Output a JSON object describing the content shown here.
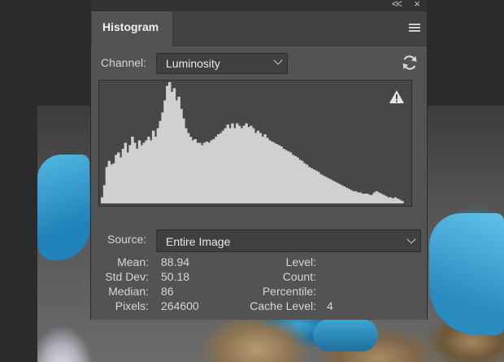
{
  "panel": {
    "tab_title": "Histogram",
    "collapse_glyph": "<<",
    "close_glyph": "×",
    "menu_icon": "hamburger-menu-icon"
  },
  "channel": {
    "label": "Channel:",
    "value": "Luminosity"
  },
  "source": {
    "label": "Source:",
    "value": "Entire Image"
  },
  "histogram": {
    "warning_icon": "warning-triangle-icon",
    "fill_color": "#d0d0d0",
    "profile": [
      0.05,
      0.15,
      0.3,
      0.35,
      0.32,
      0.33,
      0.4,
      0.42,
      0.38,
      0.45,
      0.5,
      0.42,
      0.48,
      0.55,
      0.5,
      0.45,
      0.52,
      0.48,
      0.5,
      0.52,
      0.55,
      0.52,
      0.6,
      0.55,
      0.62,
      0.68,
      0.75,
      0.85,
      0.97,
      1.0,
      0.92,
      0.95,
      0.85,
      0.88,
      0.78,
      0.7,
      0.62,
      0.58,
      0.55,
      0.52,
      0.53,
      0.5,
      0.5,
      0.48,
      0.5,
      0.51,
      0.5,
      0.52,
      0.53,
      0.55,
      0.57,
      0.58,
      0.6,
      0.62,
      0.65,
      0.62,
      0.66,
      0.62,
      0.66,
      0.64,
      0.62,
      0.64,
      0.66,
      0.63,
      0.64,
      0.62,
      0.58,
      0.6,
      0.58,
      0.55,
      0.57,
      0.54,
      0.52,
      0.51,
      0.5,
      0.49,
      0.48,
      0.47,
      0.45,
      0.44,
      0.43,
      0.42,
      0.4,
      0.39,
      0.38,
      0.36,
      0.35,
      0.33,
      0.32,
      0.3,
      0.29,
      0.28,
      0.27,
      0.26,
      0.24,
      0.23,
      0.22,
      0.21,
      0.2,
      0.19,
      0.18,
      0.17,
      0.16,
      0.15,
      0.14,
      0.13,
      0.12,
      0.11,
      0.1,
      0.1,
      0.09,
      0.09,
      0.08,
      0.08,
      0.08,
      0.07,
      0.07,
      0.09,
      0.1,
      0.09,
      0.08,
      0.07,
      0.06,
      0.05,
      0.05,
      0.04,
      0.05,
      0.04,
      0.03,
      0.02
    ]
  },
  "stats": {
    "mean": {
      "label": "Mean:",
      "value": "88.94"
    },
    "std_dev": {
      "label": "Std Dev:",
      "value": "50.18"
    },
    "median": {
      "label": "Median:",
      "value": "86"
    },
    "pixels": {
      "label": "Pixels:",
      "value": "264600"
    },
    "level": {
      "label": "Level:",
      "value": ""
    },
    "count": {
      "label": "Count:",
      "value": ""
    },
    "percentile": {
      "label": "Percentile:",
      "value": ""
    },
    "cache_level": {
      "label": "Cache Level:",
      "value": "4"
    }
  }
}
